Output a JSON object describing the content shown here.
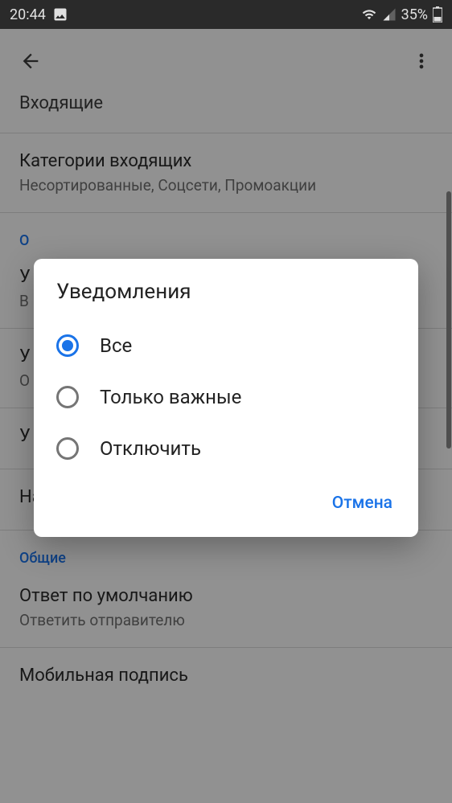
{
  "status": {
    "time": "20:44",
    "battery": "35%"
  },
  "page": {
    "title": "Входящие"
  },
  "settings": {
    "categories": {
      "title": "Категории входящих",
      "subtitle": "Несортированные, Соцсети, Промоакции"
    },
    "notifications_section": "О",
    "notifications": {
      "title_letter": "У",
      "subtitle_letter": "В"
    },
    "item2": {
      "title_letter": "У",
      "subtitle_letter": "О"
    },
    "item3": {
      "title_letter": "У"
    },
    "notification_settings": {
      "title": "Настройка уведомлений"
    },
    "general_section": "Общие",
    "default_reply": {
      "title": "Ответ по умолчанию",
      "subtitle": "Ответить отправителю"
    },
    "signature": {
      "title": "Мобильная подпись"
    }
  },
  "dialog": {
    "title": "Уведомления",
    "options": {
      "all": "Все",
      "important": "Только важные",
      "disable": "Отключить"
    },
    "cancel": "Отмена"
  }
}
